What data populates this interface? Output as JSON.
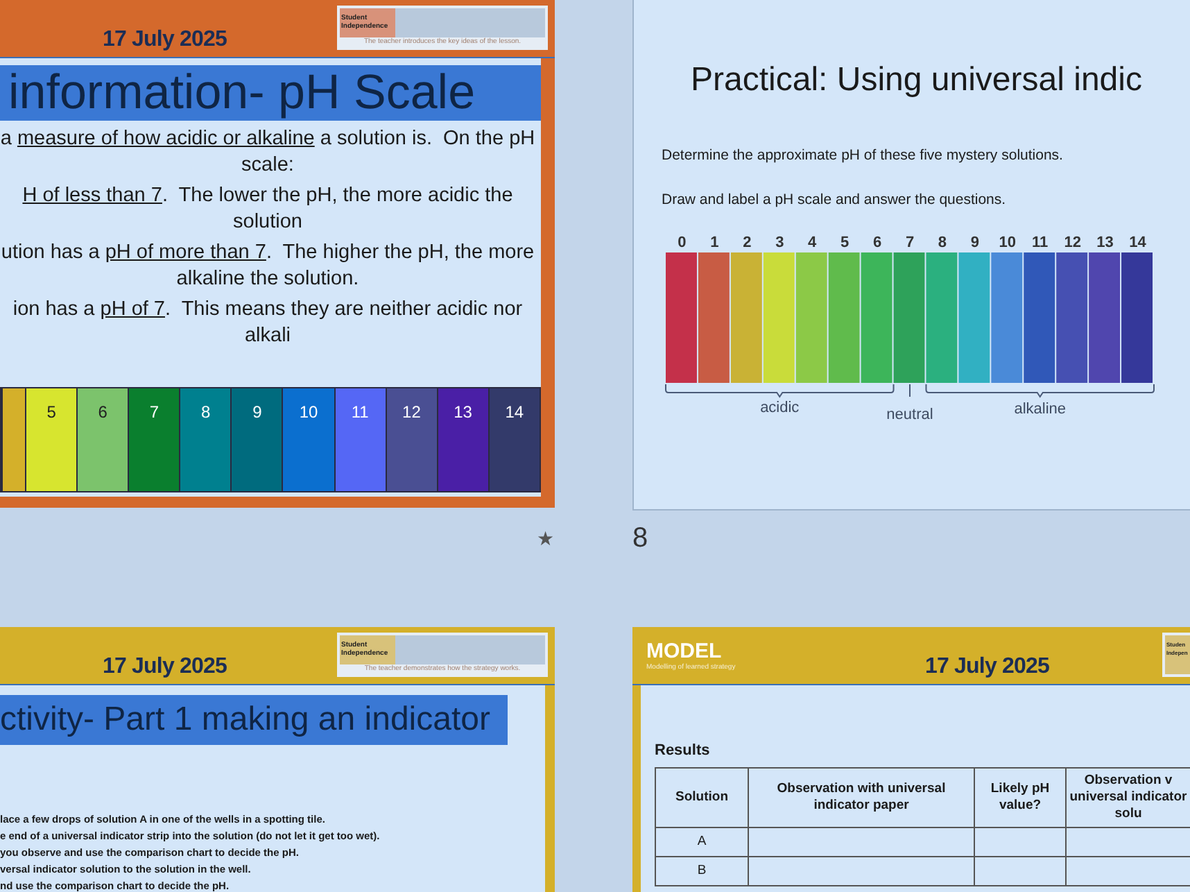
{
  "slides": [
    {
      "kind": "info",
      "color": "#d4692c",
      "transition_mark": "★",
      "date": "17 July 2025",
      "logo": {
        "label": "Student Independence",
        "caption": "The teacher introduces the key ideas of the lesson."
      },
      "title": "information- pH Scale",
      "paragraphs": [
        [
          {
            "text": "a ",
            "underlined": false
          },
          {
            "text": "measure of how acidic or alkaline",
            "underlined": true
          },
          {
            "text": " a solution is.  On the pH scale:",
            "underlined": false
          }
        ],
        [
          {
            "text": "H of less than 7",
            "underlined": true
          },
          {
            "text": ".  The lower the pH, the more acidic the solution",
            "underlined": false
          }
        ],
        [
          {
            "text": "ution has a ",
            "underlined": false
          },
          {
            "text": "pH of more than 7",
            "underlined": true
          },
          {
            "text": ".  The higher the pH, the more alkaline the solution.",
            "underlined": false
          }
        ],
        [
          {
            "text": "ion has a ",
            "underlined": false
          },
          {
            "text": "pH of 7",
            "underlined": true
          },
          {
            "text": ".  This means they are neither acidic nor alkali",
            "underlined": false
          }
        ]
      ],
      "scale": [
        {
          "color": "#d4b02a"
        },
        {
          "label": "5",
          "color": "#d7e52f"
        },
        {
          "label": "6",
          "color": "#7cc36c"
        },
        {
          "label": "7",
          "color": "#0a7f2e"
        },
        {
          "label": "8",
          "color": "#00808f"
        },
        {
          "label": "9",
          "color": "#006b7e"
        },
        {
          "label": "10",
          "color": "#0b6fcf"
        },
        {
          "label": "11",
          "color": "#5567f5"
        },
        {
          "label": "12",
          "color": "#4a4f93"
        },
        {
          "label": "13",
          "color": "#4a1fa6"
        },
        {
          "label": "14",
          "color": "#333a6a"
        }
      ]
    },
    {
      "kind": "chart",
      "slide_number": "8",
      "title": "Practical: Using universal indic",
      "lines": [
        "Determine the approximate pH of these five mystery solutions.",
        "Draw and label a pH scale and answer the questions."
      ],
      "scale": [
        {
          "label": "0",
          "color": "#c4304a"
        },
        {
          "label": "1",
          "color": "#c85c44"
        },
        {
          "label": "2",
          "color": "#c9b235"
        },
        {
          "label": "3",
          "color": "#c9dc3a"
        },
        {
          "label": "4",
          "color": "#8cc947"
        },
        {
          "label": "5",
          "color": "#60bb4c"
        },
        {
          "label": "6",
          "color": "#3db55a"
        },
        {
          "label": "7",
          "color": "#2ea25a"
        },
        {
          "label": "8",
          "color": "#2bb07f"
        },
        {
          "label": "9",
          "color": "#31b0c2"
        },
        {
          "label": "10",
          "color": "#4a8ad8"
        },
        {
          "label": "11",
          "color": "#3058b8"
        },
        {
          "label": "12",
          "color": "#4650b2"
        },
        {
          "label": "13",
          "color": "#5046ae"
        },
        {
          "label": "14",
          "color": "#35389a"
        }
      ],
      "groups": [
        "acidic",
        "neutral",
        "alkaline"
      ]
    },
    {
      "kind": "steps",
      "color": "#d4b02a",
      "date": "17 July 2025",
      "logo": {
        "label": "Student Independence",
        "caption": "The teacher demonstrates how the strategy works."
      },
      "title": "ctivity- Part 1 making an indicator",
      "steps": [
        "lace a few drops of solution A in one of the wells in a spotting tile.",
        "e end of a universal indicator strip into the solution (do not let it get too wet).",
        "you observe and use the comparison chart to decide the pH.",
        "versal indicator solution to the solution in the well.",
        "nd use the comparison chart to decide the pH."
      ]
    },
    {
      "kind": "table",
      "color": "#d4b02a",
      "badge": {
        "title": "MODEL",
        "subtitle": "Modelling of learned strategy"
      },
      "date": "17 July 2025",
      "logo": {
        "label": "Studen Indepen"
      },
      "heading": "Results",
      "columns": [
        "Solution",
        "Observation with universal indicator paper",
        "Likely pH value?",
        "Observation v universal indicator solu"
      ],
      "rows": [
        [
          "A"
        ],
        [
          "B"
        ]
      ]
    }
  ]
}
